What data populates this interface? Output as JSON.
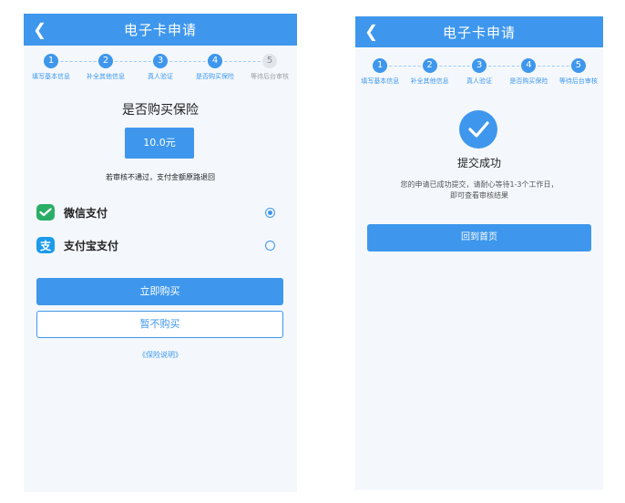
{
  "screen1": {
    "header": {
      "back_icon": "chevron-left-icon",
      "title": "电子卡申请"
    },
    "steps": [
      {
        "num": "1",
        "label": "填写基本信息",
        "done": true
      },
      {
        "num": "2",
        "label": "补全其他信息",
        "done": true
      },
      {
        "num": "3",
        "label": "真人验证",
        "done": true
      },
      {
        "num": "4",
        "label": "是否购买保险",
        "done": true
      },
      {
        "num": "5",
        "label": "等待后台审核",
        "done": false
      }
    ],
    "question": "是否购买保险",
    "price": "10.0元",
    "refund_note": "若审核不通过，支付金额原路退回",
    "payments": [
      {
        "label": "微信支付",
        "icon": "wechat-pay-icon",
        "color": "#2aae67",
        "selected": true
      },
      {
        "label": "支付宝支付",
        "icon": "alipay-icon",
        "color": "#1c9bea",
        "selected": false
      }
    ],
    "buy_button": "立即购买",
    "skip_button": "暂不购买",
    "insurance_link": "《保险说明》"
  },
  "screen2": {
    "header": {
      "back_icon": "chevron-left-icon",
      "title": "电子卡申请"
    },
    "steps": [
      {
        "num": "1",
        "label": "填写基本信息",
        "done": true
      },
      {
        "num": "2",
        "label": "补全其他信息",
        "done": true
      },
      {
        "num": "3",
        "label": "真人验证",
        "done": true
      },
      {
        "num": "4",
        "label": "是否购买保险",
        "done": true
      },
      {
        "num": "5",
        "label": "等待后台审核",
        "done": true
      }
    ],
    "success_icon": "check-circle-icon",
    "success_title": "提交成功",
    "message_line1": "您的申请已成功提交，请耐心等待1-3个工作日，",
    "message_line2": "即可查看审核结果",
    "home_button": "回到首页"
  },
  "colors": {
    "accent": "#3e97ec",
    "wechat": "#2aae67",
    "alipay": "#1c9bea",
    "pending": "#e2e6ea"
  }
}
